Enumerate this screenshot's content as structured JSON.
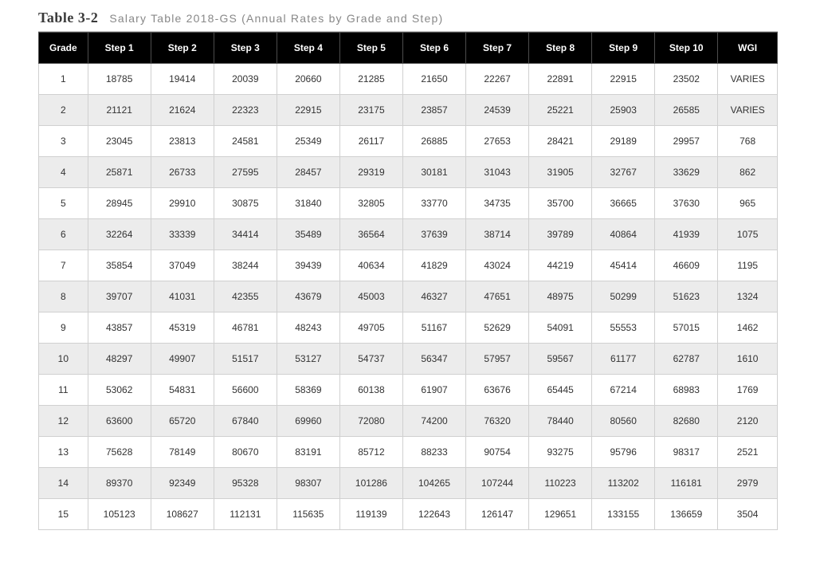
{
  "title": {
    "table_label": "Table 3-2",
    "caption": "Salary Table 2018-GS (Annual Rates by Grade and Step)"
  },
  "headers": [
    "Grade",
    "Step 1",
    "Step 2",
    "Step 3",
    "Step 4",
    "Step 5",
    "Step 6",
    "Step 7",
    "Step 8",
    "Step 9",
    "Step 10",
    "WGI"
  ],
  "rows": [
    {
      "grade": "1",
      "steps": [
        "18785",
        "19414",
        "20039",
        "20660",
        "21285",
        "21650",
        "22267",
        "22891",
        "22915",
        "23502"
      ],
      "wgi": "VARIES"
    },
    {
      "grade": "2",
      "steps": [
        "21121",
        "21624",
        "22323",
        "22915",
        "23175",
        "23857",
        "24539",
        "25221",
        "25903",
        "26585"
      ],
      "wgi": "VARIES"
    },
    {
      "grade": "3",
      "steps": [
        "23045",
        "23813",
        "24581",
        "25349",
        "26117",
        "26885",
        "27653",
        "28421",
        "29189",
        "29957"
      ],
      "wgi": "768"
    },
    {
      "grade": "4",
      "steps": [
        "25871",
        "26733",
        "27595",
        "28457",
        "29319",
        "30181",
        "31043",
        "31905",
        "32767",
        "33629"
      ],
      "wgi": "862"
    },
    {
      "grade": "5",
      "steps": [
        "28945",
        "29910",
        "30875",
        "31840",
        "32805",
        "33770",
        "34735",
        "35700",
        "36665",
        "37630"
      ],
      "wgi": "965"
    },
    {
      "grade": "6",
      "steps": [
        "32264",
        "33339",
        "34414",
        "35489",
        "36564",
        "37639",
        "38714",
        "39789",
        "40864",
        "41939"
      ],
      "wgi": "1075"
    },
    {
      "grade": "7",
      "steps": [
        "35854",
        "37049",
        "38244",
        "39439",
        "40634",
        "41829",
        "43024",
        "44219",
        "45414",
        "46609"
      ],
      "wgi": "1195"
    },
    {
      "grade": "8",
      "steps": [
        "39707",
        "41031",
        "42355",
        "43679",
        "45003",
        "46327",
        "47651",
        "48975",
        "50299",
        "51623"
      ],
      "wgi": "1324"
    },
    {
      "grade": "9",
      "steps": [
        "43857",
        "45319",
        "46781",
        "48243",
        "49705",
        "51167",
        "52629",
        "54091",
        "55553",
        "57015"
      ],
      "wgi": "1462"
    },
    {
      "grade": "10",
      "steps": [
        "48297",
        "49907",
        "51517",
        "53127",
        "54737",
        "56347",
        "57957",
        "59567",
        "61177",
        "62787"
      ],
      "wgi": "1610"
    },
    {
      "grade": "11",
      "steps": [
        "53062",
        "54831",
        "56600",
        "58369",
        "60138",
        "61907",
        "63676",
        "65445",
        "67214",
        "68983"
      ],
      "wgi": "1769"
    },
    {
      "grade": "12",
      "steps": [
        "63600",
        "65720",
        "67840",
        "69960",
        "72080",
        "74200",
        "76320",
        "78440",
        "80560",
        "82680"
      ],
      "wgi": "2120"
    },
    {
      "grade": "13",
      "steps": [
        "75628",
        "78149",
        "80670",
        "83191",
        "85712",
        "88233",
        "90754",
        "93275",
        "95796",
        "98317"
      ],
      "wgi": "2521"
    },
    {
      "grade": "14",
      "steps": [
        "89370",
        "92349",
        "95328",
        "98307",
        "101286",
        "104265",
        "107244",
        "110223",
        "113202",
        "116181"
      ],
      "wgi": "2979"
    },
    {
      "grade": "15",
      "steps": [
        "105123",
        "108627",
        "112131",
        "115635",
        "119139",
        "122643",
        "126147",
        "129651",
        "133155",
        "136659"
      ],
      "wgi": "3504"
    }
  ],
  "chart_data": {
    "type": "table",
    "title": "Salary Table 2018-GS (Annual Rates by Grade and Step)",
    "columns": [
      "Grade",
      "Step 1",
      "Step 2",
      "Step 3",
      "Step 4",
      "Step 5",
      "Step 6",
      "Step 7",
      "Step 8",
      "Step 9",
      "Step 10",
      "WGI"
    ],
    "rows": [
      [
        "1",
        18785,
        19414,
        20039,
        20660,
        21285,
        21650,
        22267,
        22891,
        22915,
        23502,
        "VARIES"
      ],
      [
        "2",
        21121,
        21624,
        22323,
        22915,
        23175,
        23857,
        24539,
        25221,
        25903,
        26585,
        "VARIES"
      ],
      [
        "3",
        23045,
        23813,
        24581,
        25349,
        26117,
        26885,
        27653,
        28421,
        29189,
        29957,
        768
      ],
      [
        "4",
        25871,
        26733,
        27595,
        28457,
        29319,
        30181,
        31043,
        31905,
        32767,
        33629,
        862
      ],
      [
        "5",
        28945,
        29910,
        30875,
        31840,
        32805,
        33770,
        34735,
        35700,
        36665,
        37630,
        965
      ],
      [
        "6",
        32264,
        33339,
        34414,
        35489,
        36564,
        37639,
        38714,
        39789,
        40864,
        41939,
        1075
      ],
      [
        "7",
        35854,
        37049,
        38244,
        39439,
        40634,
        41829,
        43024,
        44219,
        45414,
        46609,
        1195
      ],
      [
        "8",
        39707,
        41031,
        42355,
        43679,
        45003,
        46327,
        47651,
        48975,
        50299,
        51623,
        1324
      ],
      [
        "9",
        43857,
        45319,
        46781,
        48243,
        49705,
        51167,
        52629,
        54091,
        55553,
        57015,
        1462
      ],
      [
        "10",
        48297,
        49907,
        51517,
        53127,
        54737,
        56347,
        57957,
        59567,
        61177,
        62787,
        1610
      ],
      [
        "11",
        53062,
        54831,
        56600,
        58369,
        60138,
        61907,
        63676,
        65445,
        67214,
        68983,
        1769
      ],
      [
        "12",
        63600,
        65720,
        67840,
        69960,
        72080,
        74200,
        76320,
        78440,
        80560,
        82680,
        2120
      ],
      [
        "13",
        75628,
        78149,
        80670,
        83191,
        85712,
        88233,
        90754,
        93275,
        95796,
        98317,
        2521
      ],
      [
        "14",
        89370,
        92349,
        95328,
        98307,
        101286,
        104265,
        107244,
        110223,
        113202,
        116181,
        2979
      ],
      [
        "15",
        105123,
        108627,
        112131,
        115635,
        119139,
        122643,
        126147,
        129651,
        133155,
        136659,
        3504
      ]
    ]
  }
}
